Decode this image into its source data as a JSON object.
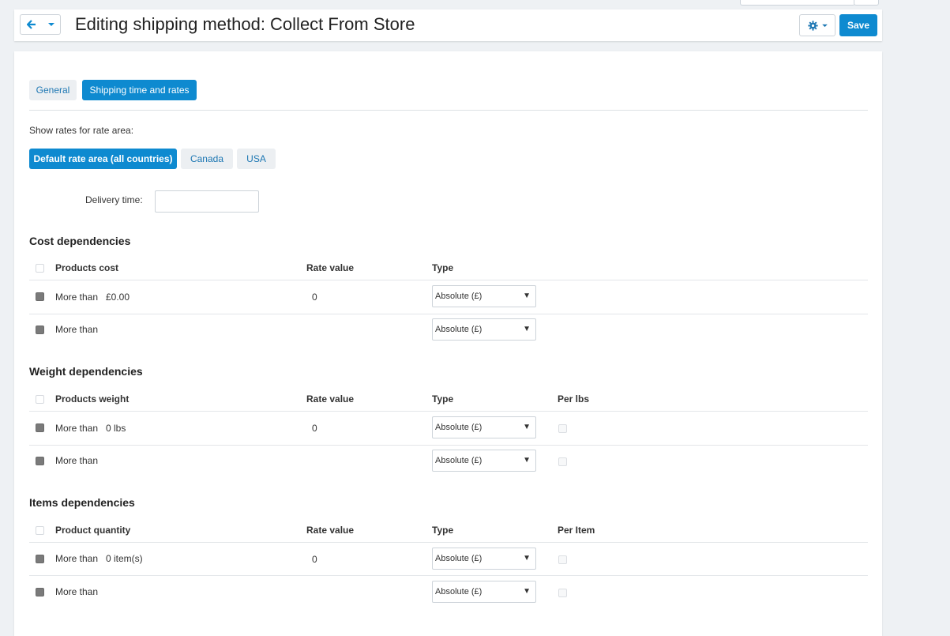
{
  "header": {
    "title": "Editing shipping method: Collect From Store",
    "save_label": "Save"
  },
  "tabs": [
    {
      "label": "General",
      "active": false
    },
    {
      "label": "Shipping time and rates",
      "active": true
    }
  ],
  "rate_area": {
    "label": "Show rates for rate area:",
    "options": [
      {
        "label": "Default rate area (all countries)",
        "active": true
      },
      {
        "label": "Canada",
        "active": false
      },
      {
        "label": "USA",
        "active": false
      }
    ]
  },
  "delivery": {
    "label": "Delivery time:",
    "value": ""
  },
  "cost": {
    "title": "Cost dependencies",
    "columns": {
      "c1": "Products cost",
      "c2": "Rate value",
      "c3": "Type"
    },
    "rows": [
      {
        "label": "More than",
        "amount": "£0.00",
        "rate": "0",
        "type": "Absolute (£)"
      },
      {
        "label": "More than",
        "amount": "",
        "rate": "",
        "type": "Absolute (£)"
      }
    ]
  },
  "weight": {
    "title": "Weight dependencies",
    "columns": {
      "c1": "Products weight",
      "c2": "Rate value",
      "c3": "Type",
      "c4": "Per lbs"
    },
    "rows": [
      {
        "label": "More than",
        "amount": "0 lbs",
        "rate": "0",
        "type": "Absolute (£)"
      },
      {
        "label": "More than",
        "amount": "",
        "rate": "",
        "type": "Absolute (£)"
      }
    ]
  },
  "items": {
    "title": "Items dependencies",
    "columns": {
      "c1": "Product quantity",
      "c2": "Rate value",
      "c3": "Type",
      "c4": "Per Item"
    },
    "rows": [
      {
        "label": "More than",
        "amount": "0 item(s)",
        "rate": "0",
        "type": "Absolute (£)"
      },
      {
        "label": "More than",
        "amount": "",
        "rate": "",
        "type": "Absolute (£)"
      }
    ]
  },
  "icons": {
    "back": "arrow-left-icon",
    "menu": "caret-down-icon",
    "gear": "gear-icon",
    "select_arrow": "triangle-down-icon"
  },
  "colors": {
    "accent": "#0e8ad0",
    "background": "#eef1f4"
  }
}
